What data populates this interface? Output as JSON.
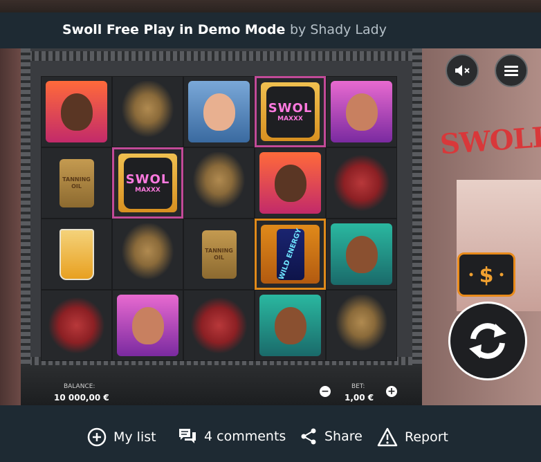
{
  "header": {
    "title": "Swoll Free Play in Demo Mode",
    "byline": "by Shady Lady"
  },
  "game": {
    "logo_sign": "SWOLL",
    "reels": [
      [
        "p1",
        "thong",
        "p2",
        "swol",
        "p3"
      ],
      [
        "oil",
        "swol",
        "thong",
        "p1",
        "steak"
      ],
      [
        "juice",
        "thong",
        "oil",
        "energy",
        "p4"
      ],
      [
        "steak",
        "p3",
        "steak",
        "p4",
        "thong"
      ]
    ],
    "symbol_text": {
      "swol_big": "SWOL",
      "swol_small": "MAXXX",
      "oil_line1": "TANNING",
      "oil_line2": "OIL",
      "energy": "WILD ENERGY"
    },
    "controls": {
      "balance_label": "BALANCE:",
      "balance_value": "10 000,00 €",
      "bet_label": "BET:",
      "bet_value": "1,00 €",
      "minus": "−",
      "plus": "+"
    }
  },
  "footer": {
    "my_list": "My list",
    "comments": "4 comments",
    "share": "Share",
    "report": "Report"
  }
}
